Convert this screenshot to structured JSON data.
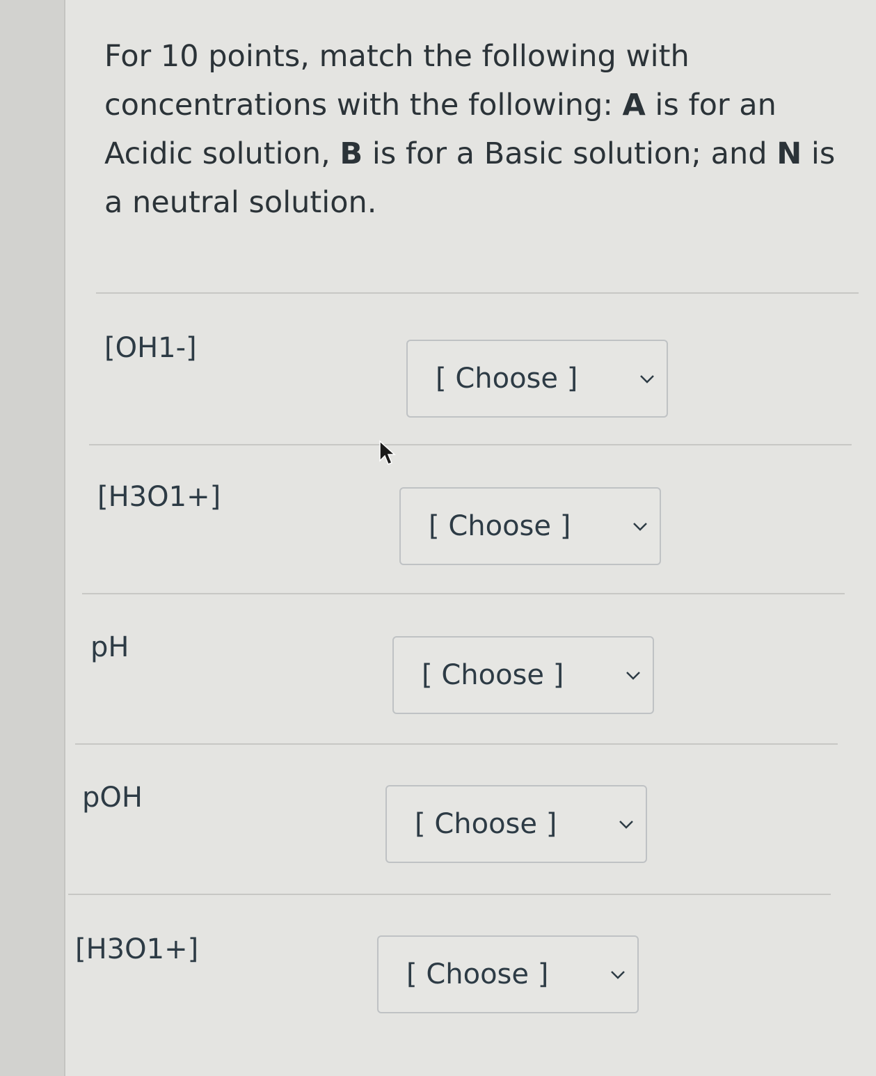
{
  "prompt": {
    "part1": "For 10 points, match the following with concentrations with the following: ",
    "a_letter": "A",
    "part2": " is for an Acidic solution, ",
    "b_letter": "B",
    "part3": " is for a Basic solution; and ",
    "n_letter": "N",
    "part4": " is a neutral solution."
  },
  "questions": [
    {
      "label": "[OH1-]",
      "selected": "[ Choose ]"
    },
    {
      "label": "[H3O1+]",
      "selected": "[ Choose ]"
    },
    {
      "label": "pH",
      "selected": "[ Choose ]"
    },
    {
      "label": "pOH",
      "selected": "[ Choose ]"
    },
    {
      "label": "[H3O1+]",
      "selected": "[ Choose ]"
    }
  ],
  "icons": {
    "dropdown": "chevron-down-icon",
    "cursor": "mouse-pointer-icon"
  },
  "colors": {
    "background": "#e4e4e1",
    "text": "#2d3b45",
    "border": "#bfc2c4"
  }
}
